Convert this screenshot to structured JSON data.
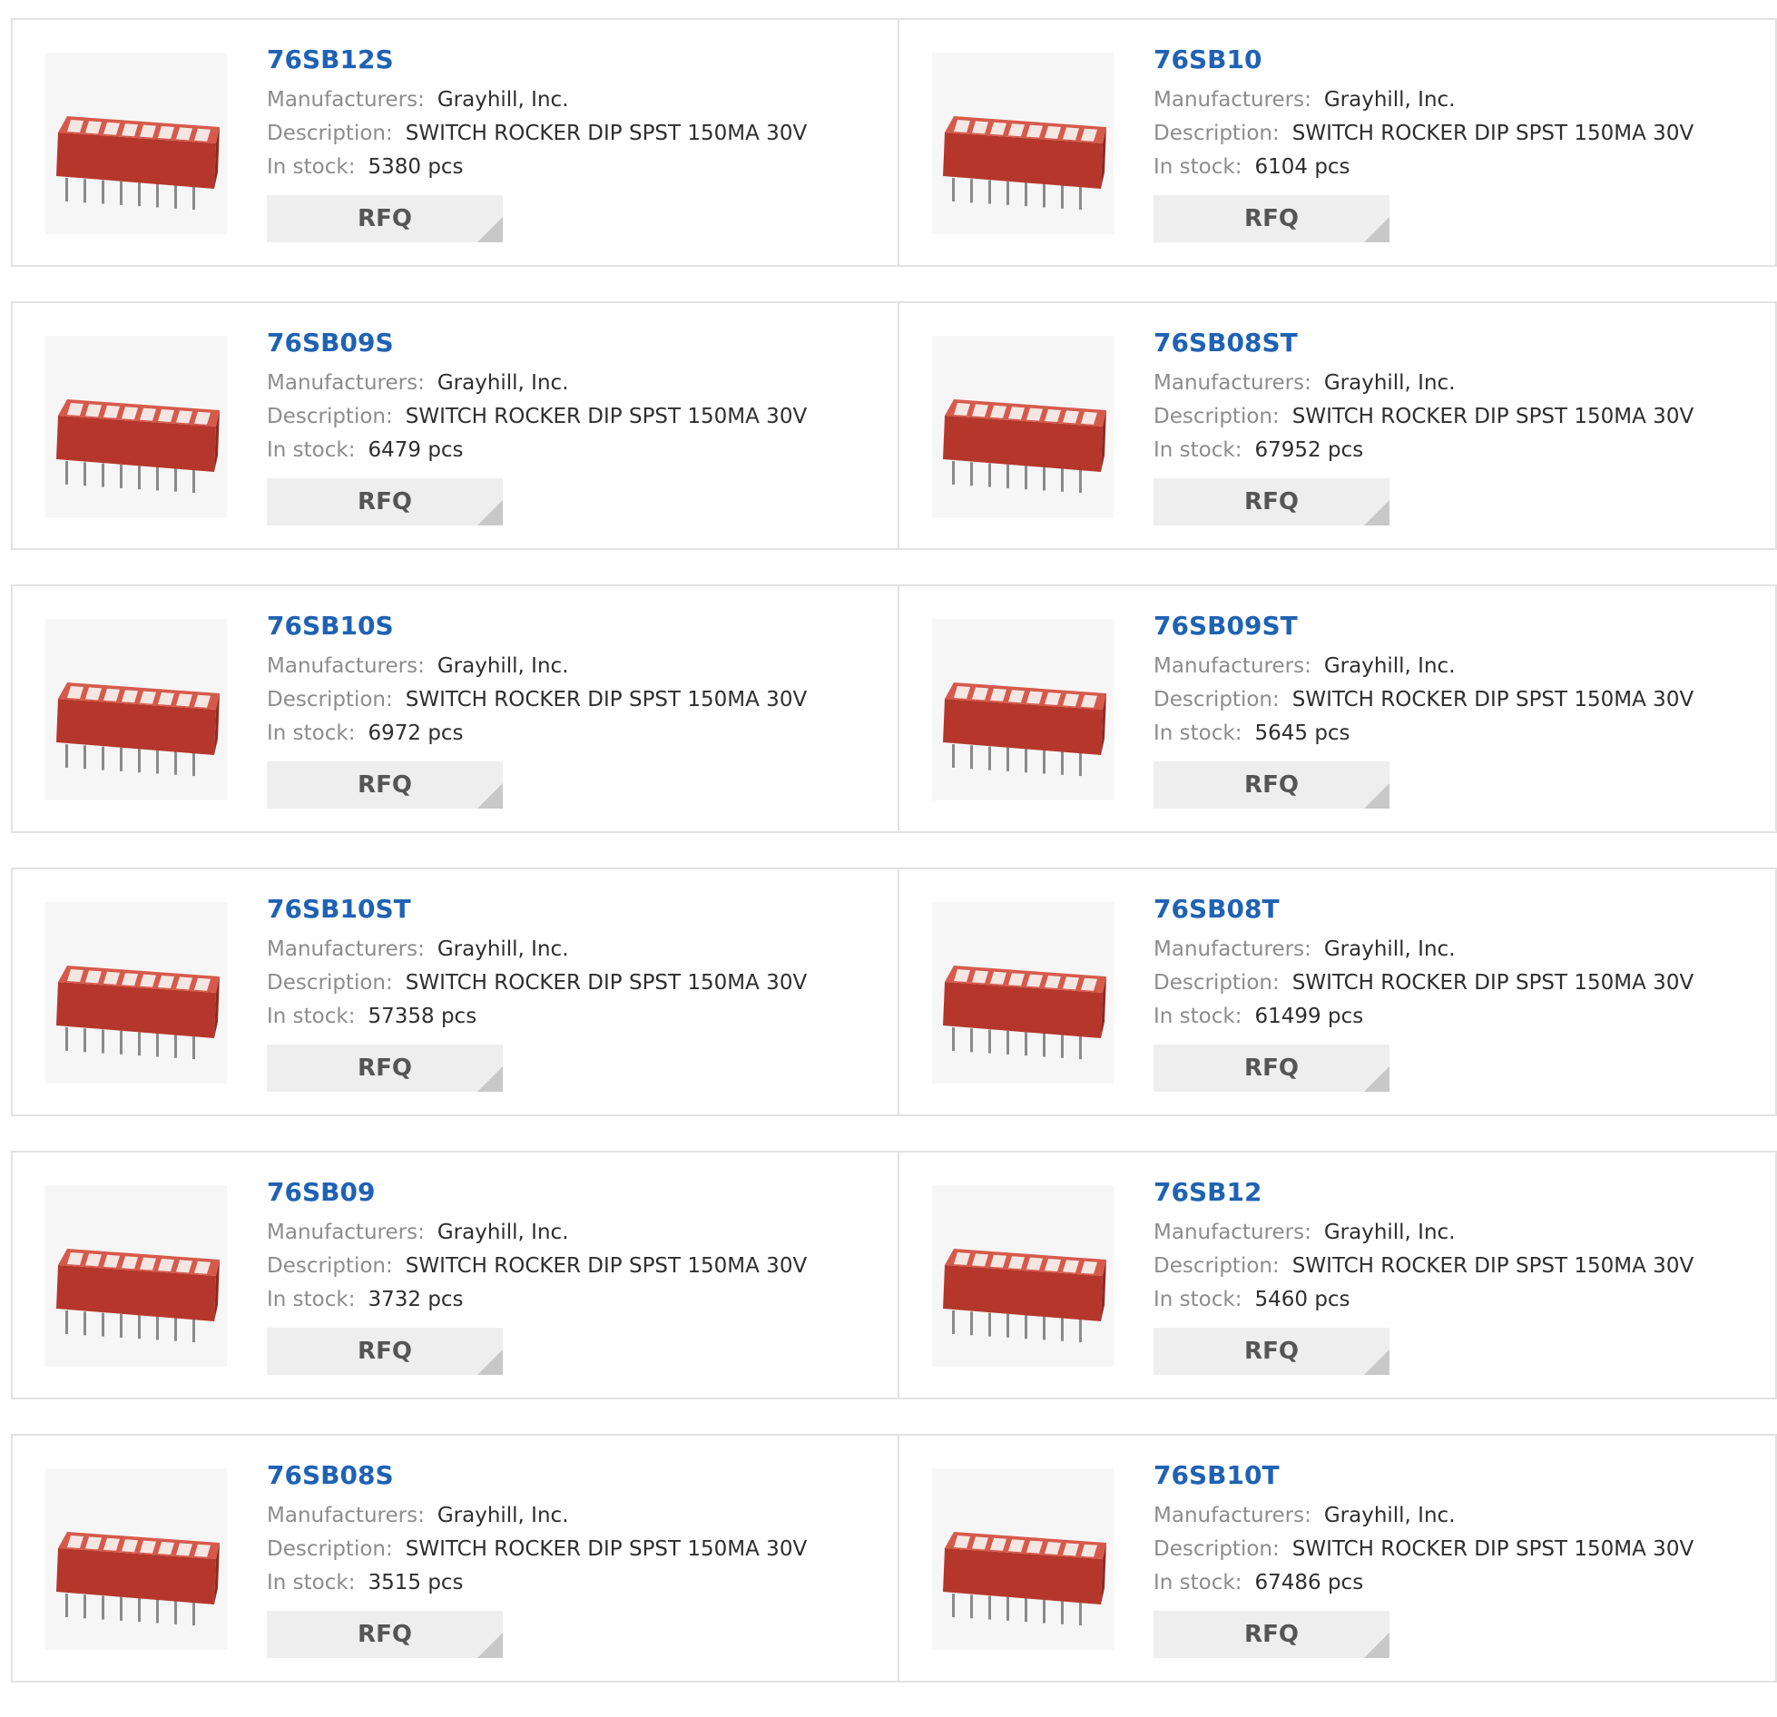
{
  "labels": {
    "manufacturers": "Manufacturers:",
    "description": "Description:",
    "in_stock": "In stock:",
    "rfq": "RFQ"
  },
  "colors": {
    "part_link": "#1f62b3",
    "switch_body": "#c0392b",
    "rfq_bg": "#eeeeee"
  },
  "products": [
    {
      "part": "76SB12S",
      "manufacturer": "Grayhill, Inc.",
      "description": "SWITCH ROCKER DIP SPST 150MA 30V",
      "stock": "5380 pcs"
    },
    {
      "part": "76SB10",
      "manufacturer": "Grayhill, Inc.",
      "description": "SWITCH ROCKER DIP SPST 150MA 30V",
      "stock": "6104 pcs"
    },
    {
      "part": "76SB09S",
      "manufacturer": "Grayhill, Inc.",
      "description": "SWITCH ROCKER DIP SPST 150MA 30V",
      "stock": "6479 pcs"
    },
    {
      "part": "76SB08ST",
      "manufacturer": "Grayhill, Inc.",
      "description": "SWITCH ROCKER DIP SPST 150MA 30V",
      "stock": "67952 pcs"
    },
    {
      "part": "76SB10S",
      "manufacturer": "Grayhill, Inc.",
      "description": "SWITCH ROCKER DIP SPST 150MA 30V",
      "stock": "6972 pcs"
    },
    {
      "part": "76SB09ST",
      "manufacturer": "Grayhill, Inc.",
      "description": "SWITCH ROCKER DIP SPST 150MA 30V",
      "stock": "5645 pcs"
    },
    {
      "part": "76SB10ST",
      "manufacturer": "Grayhill, Inc.",
      "description": "SWITCH ROCKER DIP SPST 150MA 30V",
      "stock": "57358 pcs"
    },
    {
      "part": "76SB08T",
      "manufacturer": "Grayhill, Inc.",
      "description": "SWITCH ROCKER DIP SPST 150MA 30V",
      "stock": "61499 pcs"
    },
    {
      "part": "76SB09",
      "manufacturer": "Grayhill, Inc.",
      "description": "SWITCH ROCKER DIP SPST 150MA 30V",
      "stock": "3732 pcs"
    },
    {
      "part": "76SB12",
      "manufacturer": "Grayhill, Inc.",
      "description": "SWITCH ROCKER DIP SPST 150MA 30V",
      "stock": "5460 pcs"
    },
    {
      "part": "76SB08S",
      "manufacturer": "Grayhill, Inc.",
      "description": "SWITCH ROCKER DIP SPST 150MA 30V",
      "stock": "3515 pcs"
    },
    {
      "part": "76SB10T",
      "manufacturer": "Grayhill, Inc.",
      "description": "SWITCH ROCKER DIP SPST 150MA 30V",
      "stock": "67486 pcs"
    }
  ]
}
